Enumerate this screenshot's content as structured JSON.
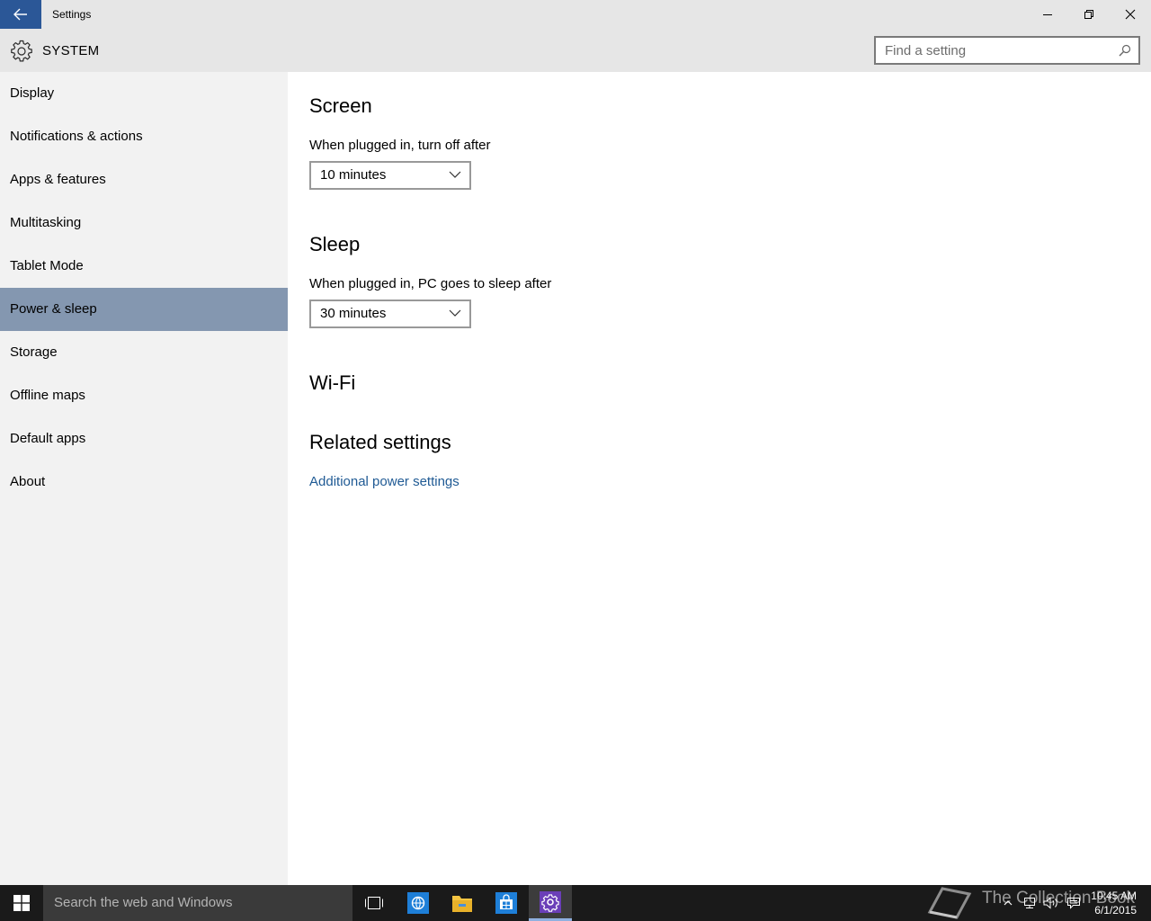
{
  "window": {
    "title": "Settings",
    "colors": {
      "back_button": "#2b5797",
      "titlebar": "#e6e6e6"
    }
  },
  "header": {
    "section_title": "SYSTEM",
    "search_placeholder": "Find a setting"
  },
  "sidebar": {
    "items": [
      {
        "label": "Display"
      },
      {
        "label": "Notifications & actions"
      },
      {
        "label": "Apps & features"
      },
      {
        "label": "Multitasking"
      },
      {
        "label": "Tablet Mode"
      },
      {
        "label": "Power & sleep",
        "selected": true
      },
      {
        "label": "Storage"
      },
      {
        "label": "Offline maps"
      },
      {
        "label": "Default apps"
      },
      {
        "label": "About"
      }
    ],
    "selected_color": "#8497b0"
  },
  "main": {
    "screen": {
      "heading": "Screen",
      "label": "When plugged in, turn off after",
      "value": "10 minutes"
    },
    "sleep": {
      "heading": "Sleep",
      "label": "When plugged in, PC goes to sleep after",
      "value": "30 minutes"
    },
    "wifi": {
      "heading": "Wi-Fi"
    },
    "related": {
      "heading": "Related settings",
      "link": "Additional power settings",
      "link_color": "#1f5a94"
    }
  },
  "taskbar": {
    "search_placeholder": "Search the web and Windows",
    "clock": {
      "time": "10:45 AM",
      "date": "6/1/2015"
    },
    "watermark": "The Collection Book",
    "icons": [
      "task-view-icon",
      "edge-icon",
      "file-explorer-icon",
      "store-icon",
      "settings-icon"
    ]
  }
}
